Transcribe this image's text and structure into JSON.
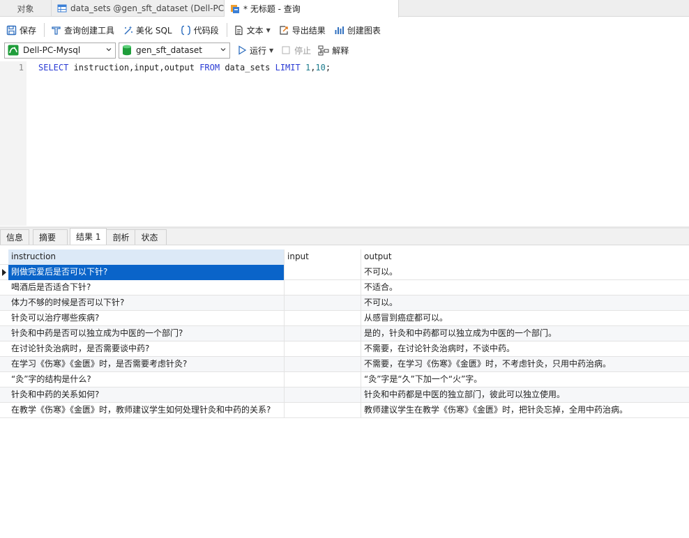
{
  "tabs": {
    "objects": "对象",
    "datasets": "data_sets @gen_sft_dataset (Dell-PC...",
    "query": "* 无标题 - 查询"
  },
  "toolbar": {
    "save": "保存",
    "query_builder": "查询创建工具",
    "beautify": "美化 SQL",
    "snippet": "代码段",
    "text": "文本",
    "export": "导出结果",
    "chart": "创建图表"
  },
  "connection": {
    "server": "Dell-PC-Mysql",
    "database": "gen_sft_dataset",
    "run": "运行",
    "stop": "停止",
    "explain": "解释"
  },
  "editor": {
    "line_number": "1",
    "code": {
      "kw_select": "SELECT",
      "cols": " instruction,input,output ",
      "kw_from": "FROM",
      "table": " data_sets ",
      "kw_limit": "LIMIT",
      "space": " ",
      "n1": "1",
      "comma": ",",
      "n2": "10",
      "semi": ";"
    }
  },
  "result_tabs": [
    "信息",
    "摘要",
    "结果 1",
    "剖析",
    "状态"
  ],
  "table": {
    "columns": [
      "instruction",
      "input",
      "output"
    ],
    "rows": [
      {
        "instruction": "刚做完爱后是否可以下针?",
        "input": "",
        "output": "不可以。"
      },
      {
        "instruction": "喝酒后是否适合下针?",
        "input": "",
        "output": "不适合。"
      },
      {
        "instruction": "体力不够的时候是否可以下针?",
        "input": "",
        "output": "不可以。"
      },
      {
        "instruction": "针灸可以治疗哪些疾病?",
        "input": "",
        "output": "从感冒到癌症都可以。"
      },
      {
        "instruction": "针灸和中药是否可以独立成为中医的一个部门?",
        "input": "",
        "output": "是的，针灸和中药都可以独立成为中医的一个部门。"
      },
      {
        "instruction": "在讨论针灸治病时，是否需要谈中药?",
        "input": "",
        "output": "不需要，在讨论针灸治病时，不谈中药。"
      },
      {
        "instruction": "在学习《伤寒》《金匮》时，是否需要考虑针灸?",
        "input": "",
        "output": "不需要，在学习《伤寒》《金匮》时，不考虑针灸，只用中药治病。"
      },
      {
        "instruction": "“灸”字的结构是什么?",
        "input": "",
        "output": "“灸”字是“久”下加一个“火”字。"
      },
      {
        "instruction": "针灸和中药的关系如何?",
        "input": "",
        "output": "针灸和中药都是中医的独立部门，彼此可以独立使用。"
      },
      {
        "instruction": "在教学《伤寒》《金匮》时，教师建议学生如何处理针灸和中药的关系?",
        "input": "",
        "output": "教师建议学生在教学《伤寒》《金匮》时，把针灸忘掉，全用中药治病。"
      }
    ]
  },
  "colors": {
    "selected_row": "#0a64c9",
    "keyword": "#2a3bd4",
    "number": "#1a7a8c",
    "header_selected": "#dce9f7"
  }
}
